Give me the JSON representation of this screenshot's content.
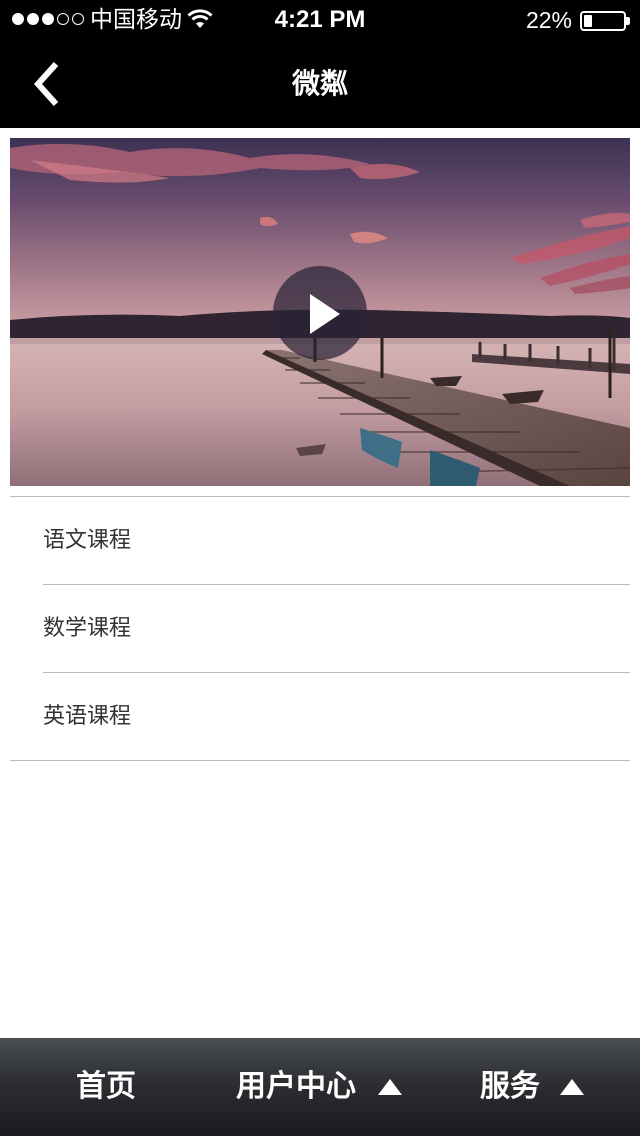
{
  "status_bar": {
    "carrier": "中国移动",
    "time": "4:21 PM",
    "battery_percent": "22%",
    "battery_level": 0.22
  },
  "nav": {
    "title": "微粼",
    "back_icon": "chevron-left-icon"
  },
  "video": {
    "play_icon": "play-icon"
  },
  "courses": [
    {
      "label": "语文课程"
    },
    {
      "label": "数学课程"
    },
    {
      "label": "英语课程"
    }
  ],
  "tab_bar": {
    "items": [
      {
        "label": "首页",
        "has_submenu": false
      },
      {
        "label": "用户中心",
        "has_submenu": true
      },
      {
        "label": "服务",
        "has_submenu": true
      }
    ]
  },
  "colors": {
    "bar_background": "#000000",
    "divider": "#b9b9b9",
    "text": "#333333"
  }
}
